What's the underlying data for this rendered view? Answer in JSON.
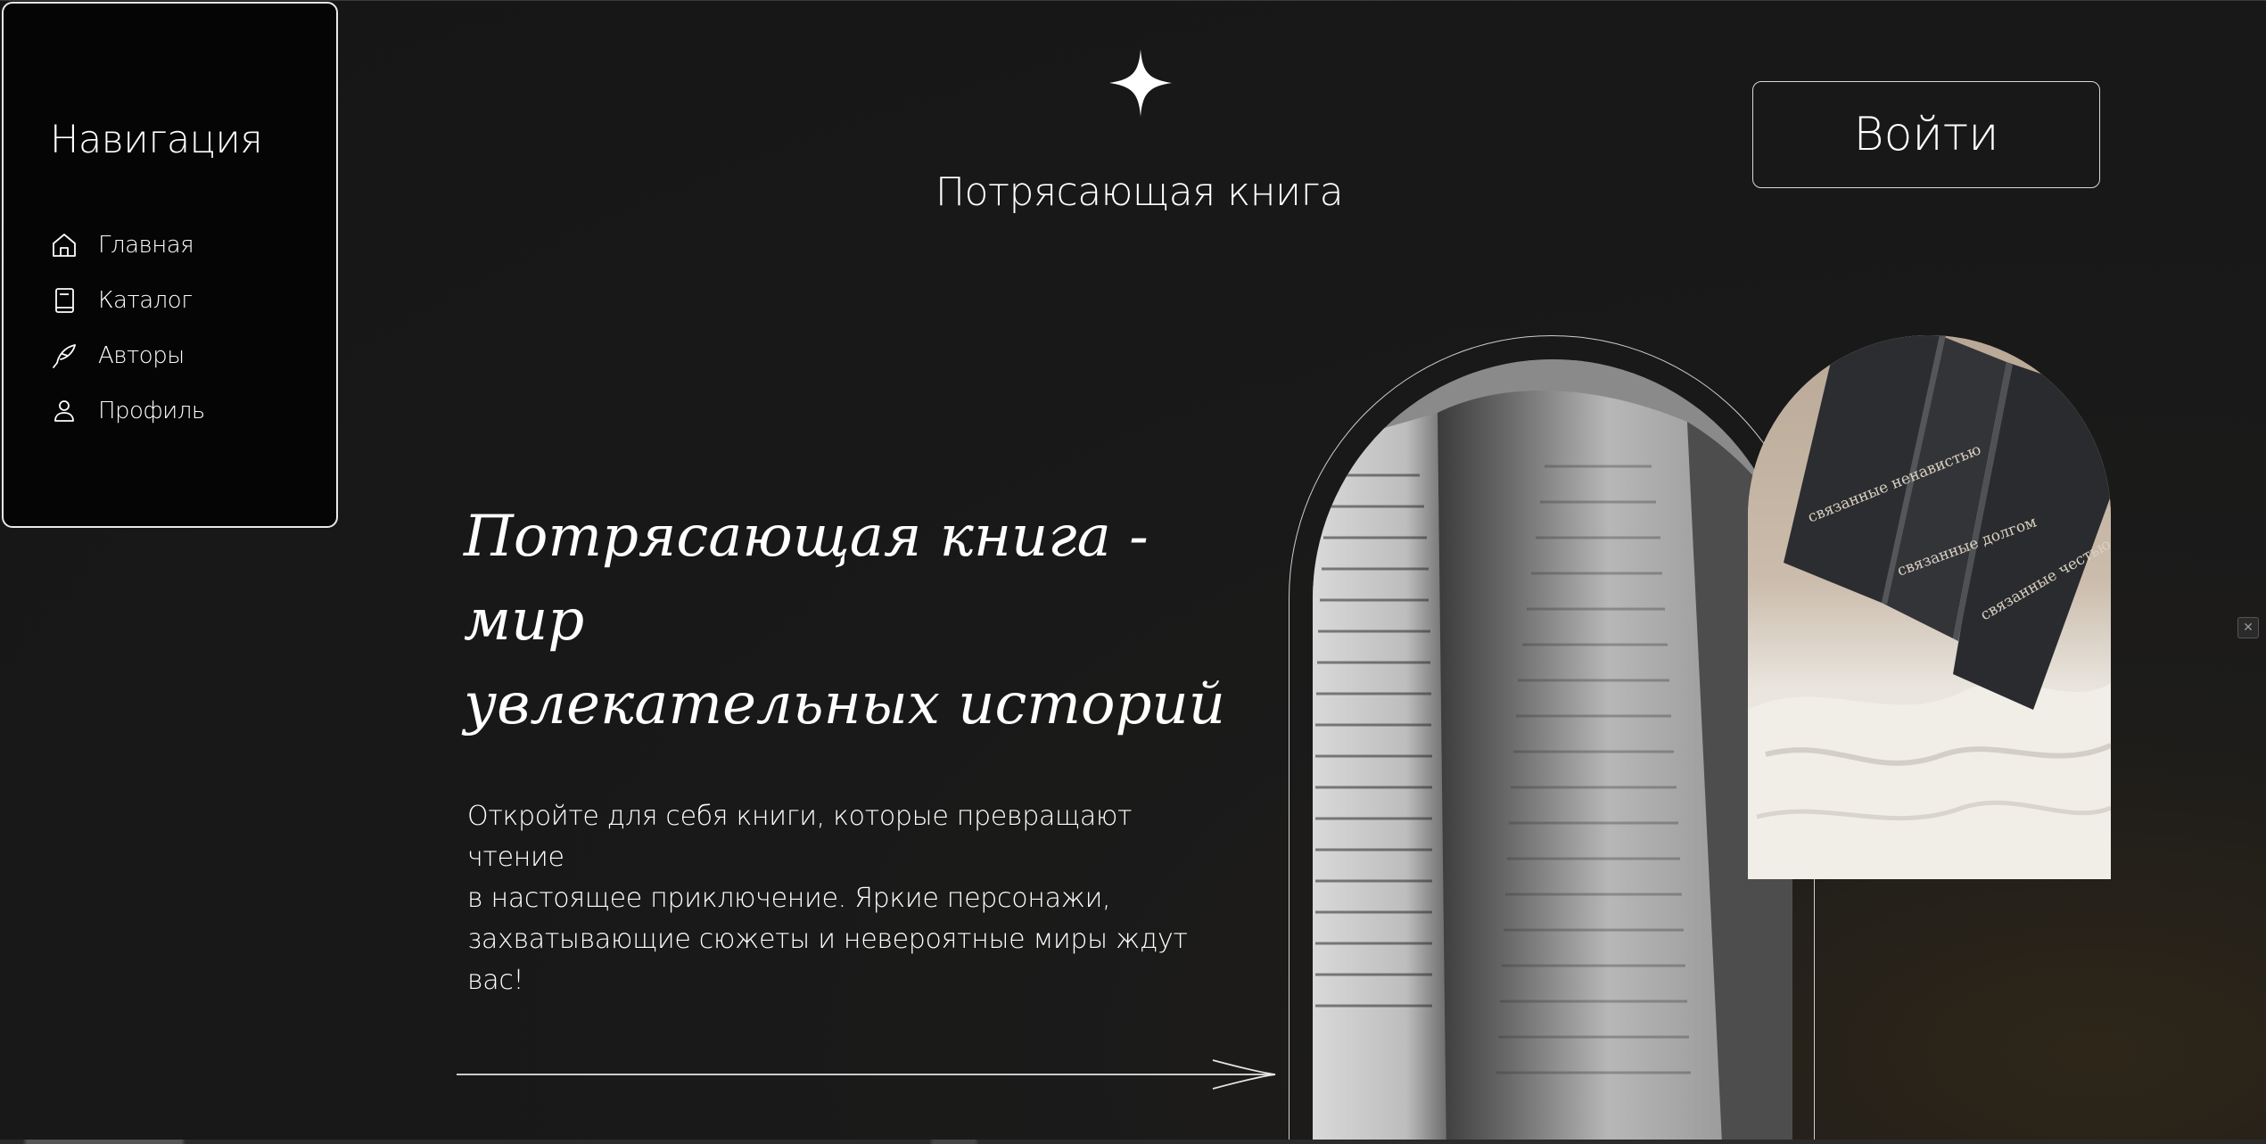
{
  "sidebar": {
    "title": "Навигация",
    "items": [
      {
        "label": "Главная",
        "icon": "home-icon"
      },
      {
        "label": "Каталог",
        "icon": "book-icon"
      },
      {
        "label": "Авторы",
        "icon": "quill-pen-icon"
      },
      {
        "label": "Профиль",
        "icon": "user-icon"
      }
    ]
  },
  "header": {
    "logo_icon": "sparkle-star-icon",
    "site_title": "Потрясающая книга",
    "login_label": "Войти"
  },
  "hero": {
    "heading_line1": "Потрясающая книга - мир",
    "heading_line2": "увлекательных историй",
    "text_line1": "Откройте для себя книги, которые превращают чтение",
    "text_line2": "в настоящее приключение. Яркие персонажи,",
    "text_line3": "захватывающие сюжеты и невероятные миры ждут вас!",
    "arrow_icon": "long-arrow-right-icon"
  },
  "images": {
    "book_spines": [
      "связанные ненавистью",
      "связанные долгом",
      "связанные честью"
    ]
  },
  "colors": {
    "background": "#1a1a1a",
    "sidebar_bg": "#050505",
    "text": "#ffffff",
    "border": "#e9e9e9"
  }
}
